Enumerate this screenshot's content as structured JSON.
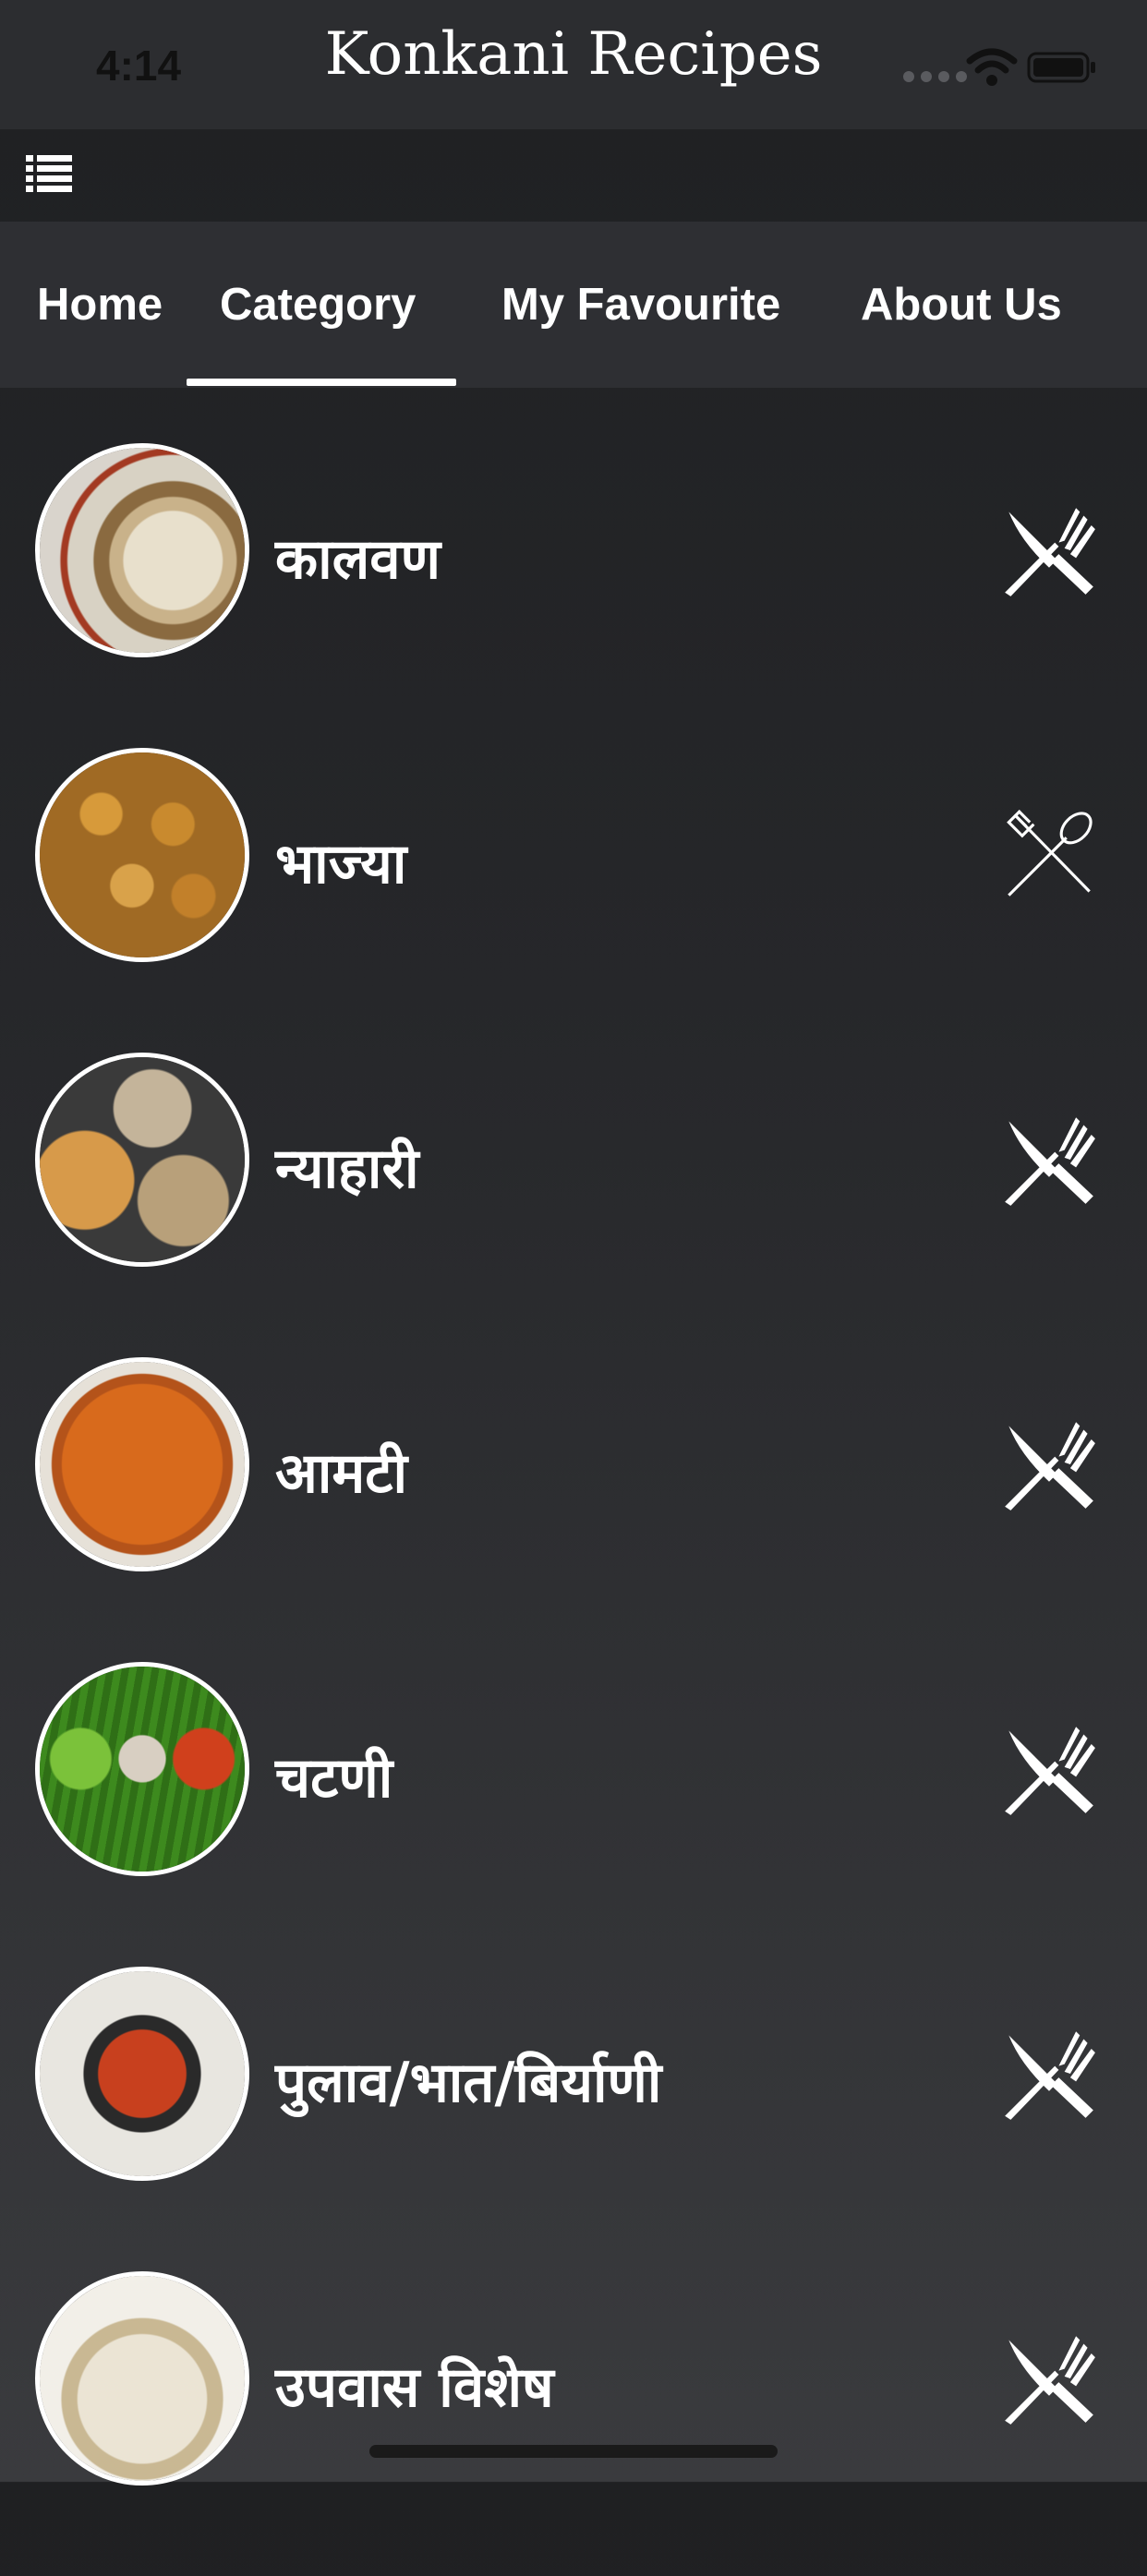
{
  "status_bar": {
    "time": "4:14"
  },
  "app_bar": {
    "title": "Konkani Recipes"
  },
  "tabs": [
    {
      "label": "Home"
    },
    {
      "label": "Category"
    },
    {
      "label": "My Favourite"
    },
    {
      "label": "About Us"
    }
  ],
  "active_tab": "Category",
  "categories": [
    {
      "label": "कालवण",
      "icon": "cutlery-solid-icon"
    },
    {
      "label": "भाज्या",
      "icon": "fork-spoon-outline-icon"
    },
    {
      "label": "न्याहारी",
      "icon": "cutlery-solid-icon"
    },
    {
      "label": "आमटी",
      "icon": "cutlery-solid-icon"
    },
    {
      "label": "चटणी",
      "icon": "cutlery-solid-icon"
    },
    {
      "label": "पुलाव/भात/बिर्याणी",
      "icon": "cutlery-solid-icon"
    },
    {
      "label": "उपवास विशेष",
      "icon": "cutlery-solid-icon"
    }
  ],
  "colors": {
    "background_top": "#1f2022",
    "background_bottom": "#3a3b3e",
    "tab_bar": "#2e2f33",
    "text": "#ffffff"
  }
}
